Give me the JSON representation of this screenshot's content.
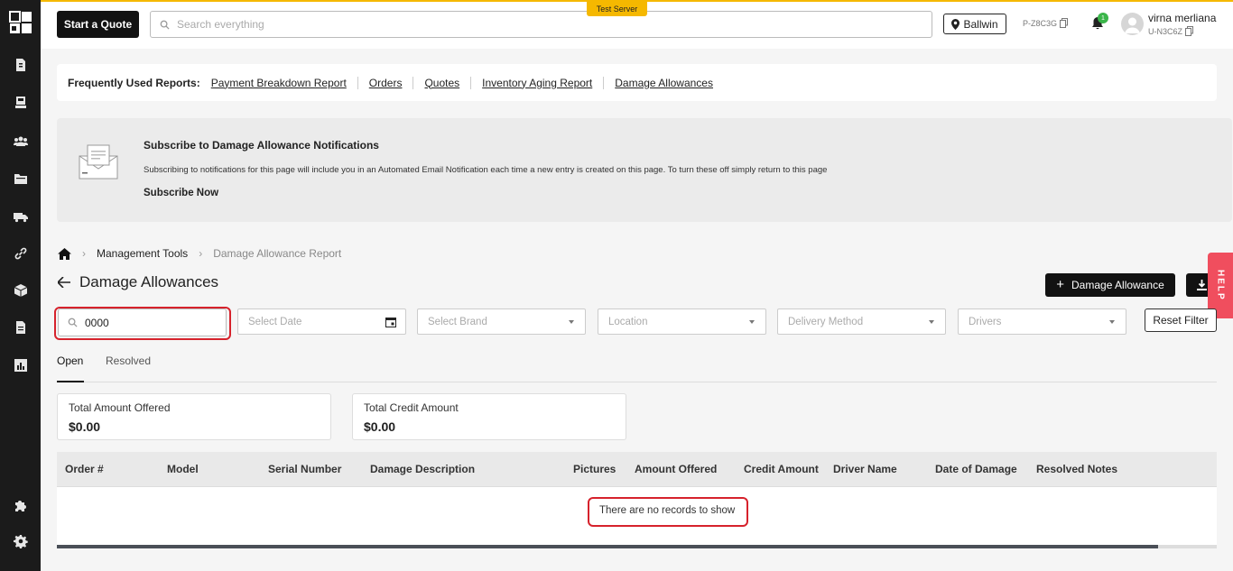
{
  "header": {
    "quote_button": "Start a Quote",
    "search_placeholder": "Search everything",
    "test_server": "Test Server",
    "location": "Ballwin",
    "pcode": "P-Z8C3G",
    "notification_count": "1",
    "user_name": "virna merliana",
    "user_code": "U-N3C6Z"
  },
  "reports": {
    "label": "Frequently Used Reports:",
    "links": [
      "Payment Breakdown Report",
      "Orders",
      "Quotes",
      "Inventory Aging Report",
      "Damage Allowances"
    ]
  },
  "subscribe": {
    "title": "Subscribe to Damage Allowance Notifications",
    "description": "Subscribing to notifications for this page will include you in an Automated Email Notification each time a new entry is created on this page. To turn these off simply return to this page",
    "link": "Subscribe Now"
  },
  "breadcrumb": {
    "items": [
      "Management Tools",
      "Damage Allowance Report"
    ]
  },
  "page": {
    "title": "Damage Allowances",
    "add_button": "Damage Allowance",
    "help": "HELP"
  },
  "filters": {
    "search_value": "0000",
    "date_placeholder": "Select Date",
    "brand_placeholder": "Select Brand",
    "location_placeholder": "Location",
    "delivery_placeholder": "Delivery Method",
    "drivers_placeholder": "Drivers",
    "reset": "Reset Filter"
  },
  "tabs": [
    "Open",
    "Resolved"
  ],
  "summary": [
    {
      "title": "Total Amount Offered",
      "value": "$0.00"
    },
    {
      "title": "Total Credit Amount",
      "value": "$0.00"
    }
  ],
  "table": {
    "columns": [
      "Order #",
      "Model",
      "Serial Number",
      "Damage Description",
      "Pictures",
      "Amount Offered",
      "Credit Amount",
      "Driver Name",
      "Date of Damage",
      "Resolved Notes"
    ],
    "empty_message": "There are no records to show"
  },
  "colors": {
    "accent": "#f5b800",
    "dark": "#121212",
    "help": "#f04e5e",
    "highlight": "#d6222c"
  }
}
